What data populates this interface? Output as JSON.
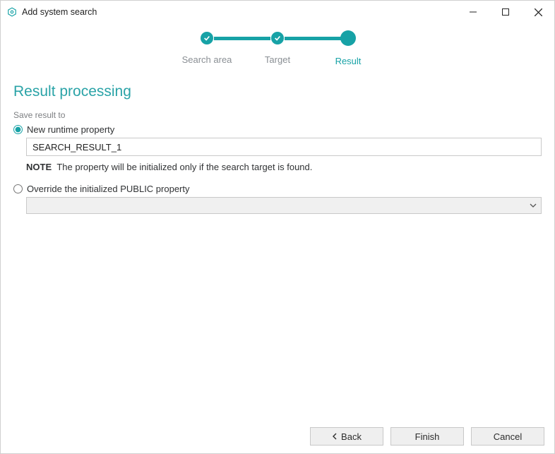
{
  "window": {
    "title": "Add system search"
  },
  "stepper": {
    "steps": [
      {
        "label": "Search area",
        "state": "done"
      },
      {
        "label": "Target",
        "state": "done"
      },
      {
        "label": "Result",
        "state": "current"
      }
    ]
  },
  "page": {
    "heading": "Result processing",
    "group_label": "Save result to",
    "option_new_runtime": {
      "label": "New runtime property",
      "value": "SEARCH_RESULT_1",
      "selected": true
    },
    "note_prefix": "NOTE",
    "note_text": "The property will be initialized only if the search target is found.",
    "option_override": {
      "label": "Override the initialized PUBLIC property",
      "value": "",
      "selected": false
    }
  },
  "footer": {
    "back": "Back",
    "finish": "Finish",
    "cancel": "Cancel"
  }
}
